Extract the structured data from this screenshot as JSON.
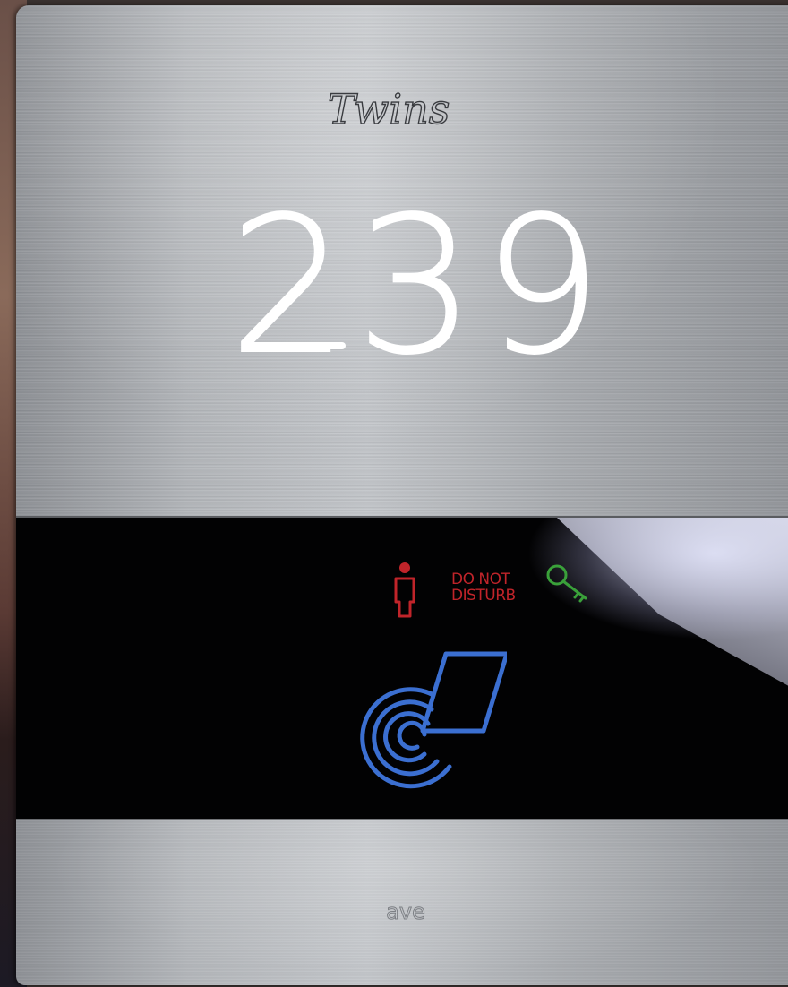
{
  "panel": {
    "brand_text": "Twins",
    "room_number": "239",
    "indicators": {
      "do_not_disturb_text": "DO NOT\nDISTURB",
      "do_not_disturb_icon": "person-icon",
      "housekeeping_icon": "key-icon",
      "dnd_color": "#c0242a",
      "key_color": "#3aa13a"
    },
    "card_reader": {
      "icon": "contactless-card-icon",
      "color": "#3b6fd1"
    },
    "maker_logo_text": "ave"
  }
}
